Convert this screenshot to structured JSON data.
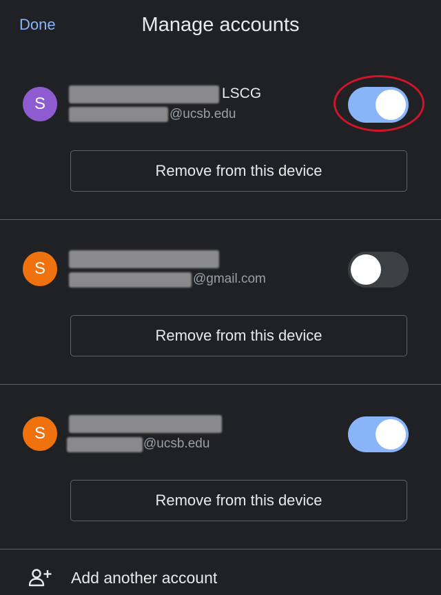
{
  "header": {
    "done_label": "Done",
    "title": "Manage accounts"
  },
  "accounts": [
    {
      "avatar_letter": "S",
      "avatar_color": "#8e5bd0",
      "name_suffix": "LSCG",
      "email_domain": "@ucsb.edu",
      "sync_on": true,
      "highlighted": true,
      "remove_label": "Remove from this device"
    },
    {
      "avatar_letter": "S",
      "avatar_color": "#f0720f",
      "name_suffix": "",
      "email_domain": "@gmail.com",
      "sync_on": false,
      "highlighted": false,
      "remove_label": "Remove from this device"
    },
    {
      "avatar_letter": "S",
      "avatar_color": "#f0720f",
      "name_suffix": "",
      "email_domain": "@ucsb.edu",
      "sync_on": true,
      "highlighted": false,
      "remove_label": "Remove from this device"
    }
  ],
  "footer": {
    "add_account_label": "Add another account",
    "add_account_icon": "add-person-icon"
  },
  "colors": {
    "background": "#202124",
    "accent": "#8ab4f8",
    "highlight_ring": "#d0152b"
  }
}
